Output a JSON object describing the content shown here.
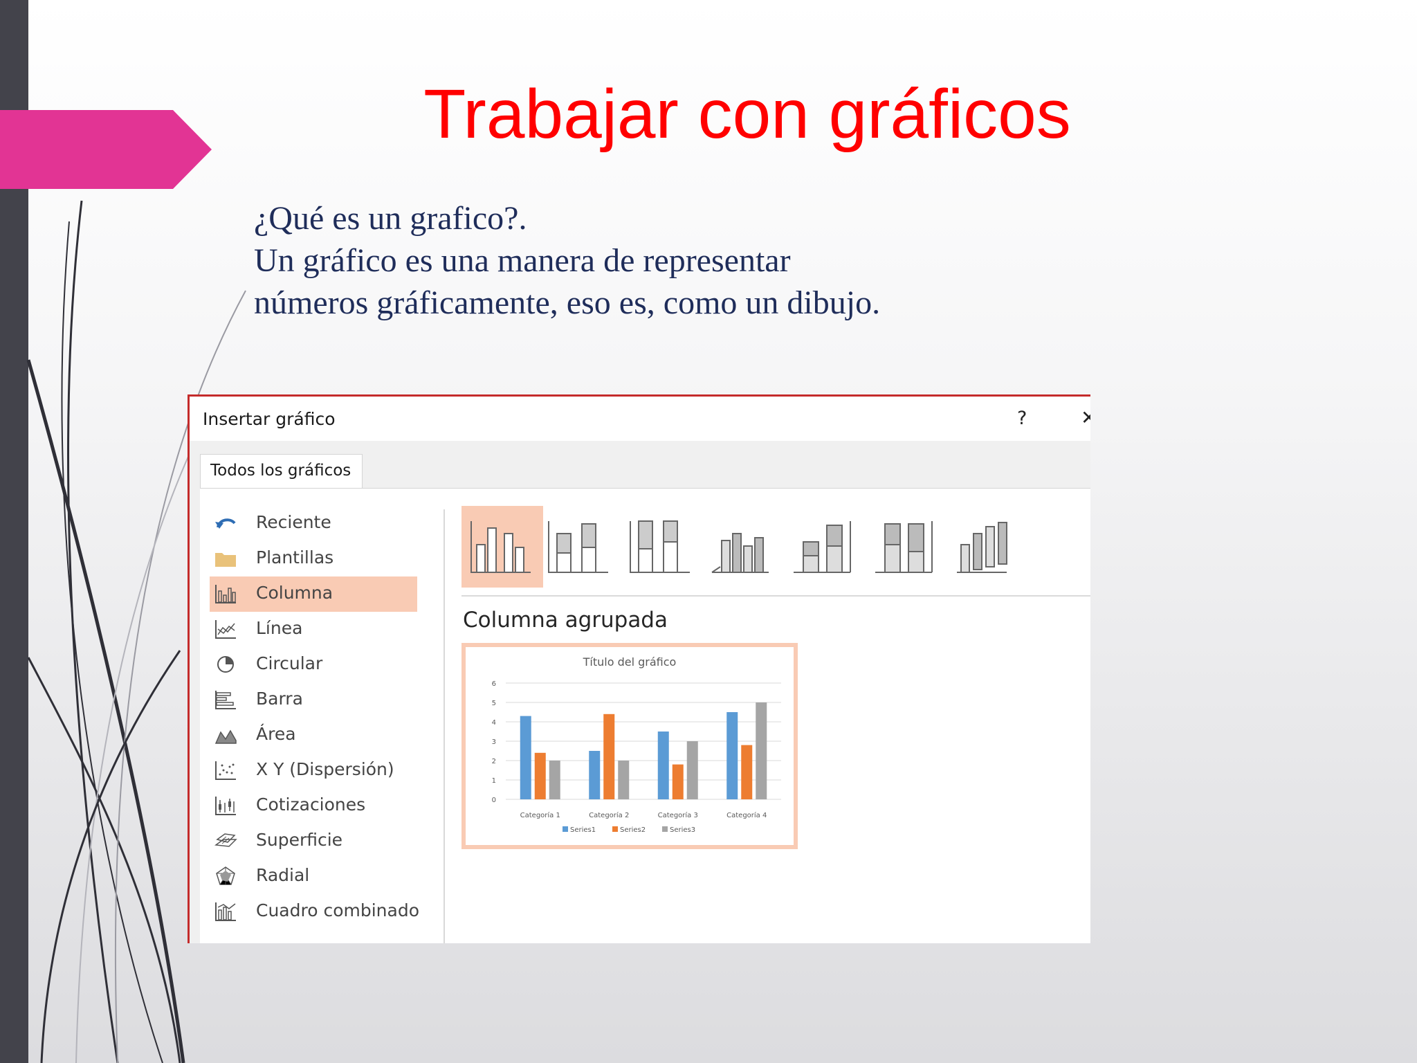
{
  "slide": {
    "title": "Trabajar con gráficos",
    "body_lines": [
      "¿Qué es un grafico?.",
      "Un gráfico es una manera de representar",
      "números gráficamente, eso es, como un dibujo."
    ]
  },
  "dialog": {
    "title": "Insertar gráfico",
    "help": "?",
    "close": "✕",
    "tab": "Todos los gráficos",
    "sidebar": [
      {
        "label": "Reciente",
        "icon": "recent-icon"
      },
      {
        "label": "Plantillas",
        "icon": "folder-icon"
      },
      {
        "label": "Columna",
        "icon": "column-chart-icon",
        "selected": true
      },
      {
        "label": "Línea",
        "icon": "line-chart-icon"
      },
      {
        "label": "Circular",
        "icon": "pie-chart-icon"
      },
      {
        "label": "Barra",
        "icon": "bar-chart-icon"
      },
      {
        "label": "Área",
        "icon": "area-chart-icon"
      },
      {
        "label": "X Y (Dispersión)",
        "icon": "scatter-chart-icon"
      },
      {
        "label": "Cotizaciones",
        "icon": "stock-chart-icon"
      },
      {
        "label": "Superficie",
        "icon": "surface-chart-icon"
      },
      {
        "label": "Radial",
        "icon": "radar-chart-icon"
      },
      {
        "label": "Cuadro combinado",
        "icon": "combo-chart-icon"
      }
    ],
    "gallery": [
      "clustered-column-icon",
      "stacked-column-icon",
      "100-stacked-column-icon",
      "3d-clustered-column-icon",
      "3d-stacked-column-icon",
      "3d-100-stacked-column-icon",
      "3d-column-icon"
    ],
    "subtype_name": "Columna agrupada"
  },
  "colors": {
    "accent": "#e23494",
    "title": "#ff0000",
    "selection": "#f9cbb4",
    "series1": "#5b9bd5",
    "series2": "#ed7d31",
    "series3": "#a5a5a5"
  },
  "chart_data": {
    "type": "bar",
    "title": "Título del gráfico",
    "categories": [
      "Categoría 1",
      "Categoría 2",
      "Categoría 3",
      "Categoría 4"
    ],
    "series": [
      {
        "name": "Series1",
        "values": [
          4.3,
          2.5,
          3.5,
          4.5
        ]
      },
      {
        "name": "Series2",
        "values": [
          2.4,
          4.4,
          1.8,
          2.8
        ]
      },
      {
        "name": "Series3",
        "values": [
          2,
          2,
          3,
          5
        ]
      }
    ],
    "ylim": [
      0,
      6
    ],
    "yticks": [
      "0",
      "1",
      "2",
      "3",
      "4",
      "5",
      "6"
    ],
    "grid": true,
    "legend": "bottom"
  }
}
